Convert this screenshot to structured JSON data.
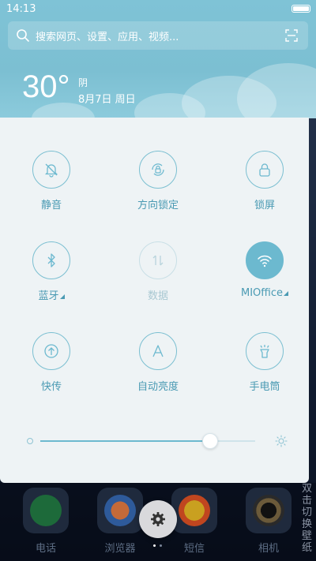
{
  "status_bar": {
    "time": "14:13"
  },
  "search": {
    "placeholder": "搜索网页、设置、应用、视频..."
  },
  "weather": {
    "temperature": "30°",
    "condition": "阴",
    "date": "8月7日 周日"
  },
  "toggles": [
    {
      "label": "静音",
      "icon": "bell-off-icon",
      "state": "inactive"
    },
    {
      "label": "方向锁定",
      "icon": "rotation-lock-icon",
      "state": "inactive"
    },
    {
      "label": "锁屏",
      "icon": "lock-icon",
      "state": "inactive"
    },
    {
      "label": "蓝牙",
      "icon": "bluetooth-icon",
      "state": "inactive",
      "expandable": true
    },
    {
      "label": "数据",
      "icon": "data-icon",
      "state": "disabled"
    },
    {
      "label": "MIOffice",
      "icon": "wifi-icon",
      "state": "active",
      "expandable": true
    },
    {
      "label": "快传",
      "icon": "quick-share-icon",
      "state": "inactive"
    },
    {
      "label": "自动亮度",
      "icon": "auto-brightness-icon",
      "state": "inactive"
    },
    {
      "label": "手电筒",
      "icon": "flashlight-icon",
      "state": "inactive"
    }
  ],
  "brightness": {
    "level": 0.79
  },
  "dock": {
    "apps": [
      {
        "label": "电话",
        "icon": "phone-app-icon"
      },
      {
        "label": "浏览器",
        "icon": "browser-app-icon"
      },
      {
        "label": "短信",
        "icon": "sms-app-icon"
      },
      {
        "label": "相机",
        "icon": "camera-app-icon"
      }
    ],
    "side_text": "双击切换壁纸"
  },
  "colors": {
    "accent": "#6cb9cf",
    "panel": "#eef3f5",
    "header": "#7cbfd2"
  }
}
